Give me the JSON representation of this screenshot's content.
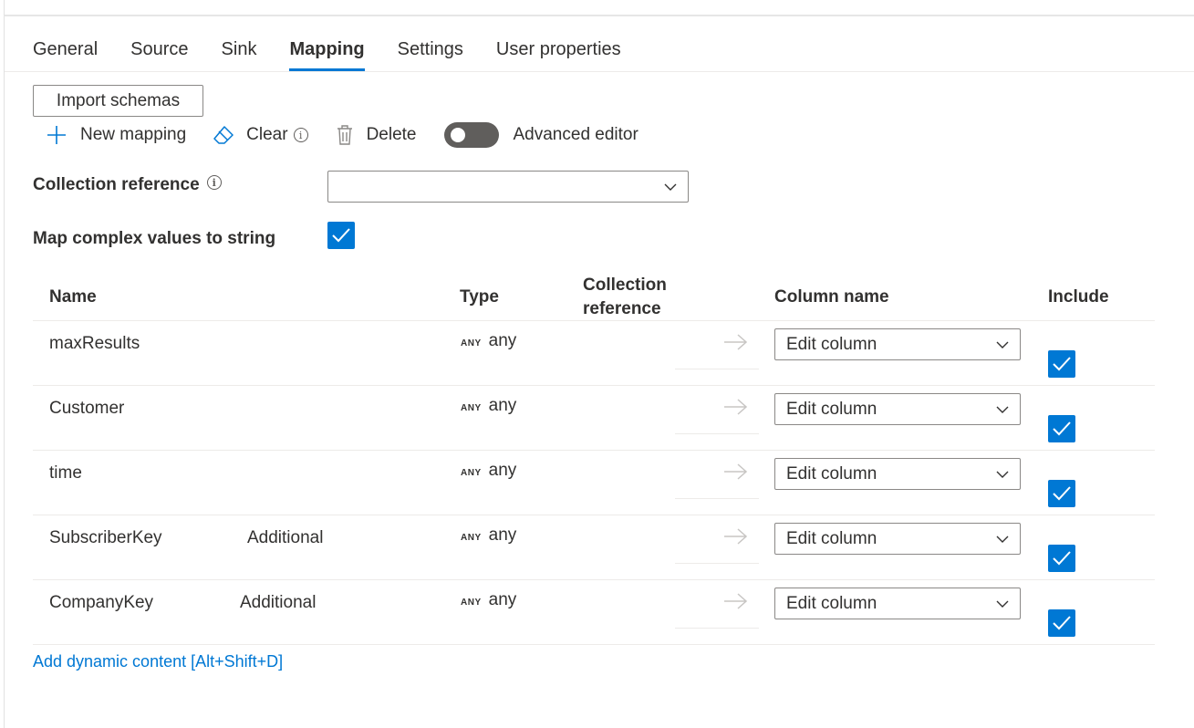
{
  "tabs": [
    {
      "label": "General",
      "active": false
    },
    {
      "label": "Source",
      "active": false
    },
    {
      "label": "Sink",
      "active": false
    },
    {
      "label": "Mapping",
      "active": true
    },
    {
      "label": "Settings",
      "active": false
    },
    {
      "label": "User properties",
      "active": false
    }
  ],
  "toolbar": {
    "import_label": "Import schemas",
    "new_mapping_label": "New mapping",
    "clear_label": "Clear",
    "delete_label": "Delete",
    "advanced_editor_label": "Advanced editor",
    "advanced_editor_on": false
  },
  "form": {
    "collection_reference_label": "Collection reference",
    "collection_reference_value": "",
    "map_complex_label": "Map complex values to string",
    "map_complex_checked": true
  },
  "table": {
    "headers": {
      "name": "Name",
      "type": "Type",
      "collection_reference": "Collection reference",
      "column_name": "Column name",
      "include": "Include"
    },
    "rows": [
      {
        "name": "maxResults",
        "extra": "",
        "type_badge": "ANY",
        "type": "any",
        "column_placeholder": "Edit column",
        "include": true
      },
      {
        "name": "Customer",
        "extra": "",
        "type_badge": "ANY",
        "type": "any",
        "column_placeholder": "Edit column",
        "include": true
      },
      {
        "name": "time",
        "extra": "",
        "type_badge": "ANY",
        "type": "any",
        "column_placeholder": "Edit column",
        "include": true
      },
      {
        "name": "SubscriberKey",
        "extra": "Additional",
        "type_badge": "ANY",
        "type": "any",
        "column_placeholder": "Edit column",
        "include": true
      },
      {
        "name": "CompanyKey",
        "extra": "Additional",
        "type_badge": "ANY",
        "type": "any",
        "column_placeholder": "Edit column",
        "include": true
      }
    ]
  },
  "footer": {
    "dynamic_content_link": "Add dynamic content [Alt+Shift+D]"
  },
  "colors": {
    "accent": "#0078d4",
    "toggle_off": "#605e5c",
    "text": "#323130",
    "border": "#8a8886"
  }
}
